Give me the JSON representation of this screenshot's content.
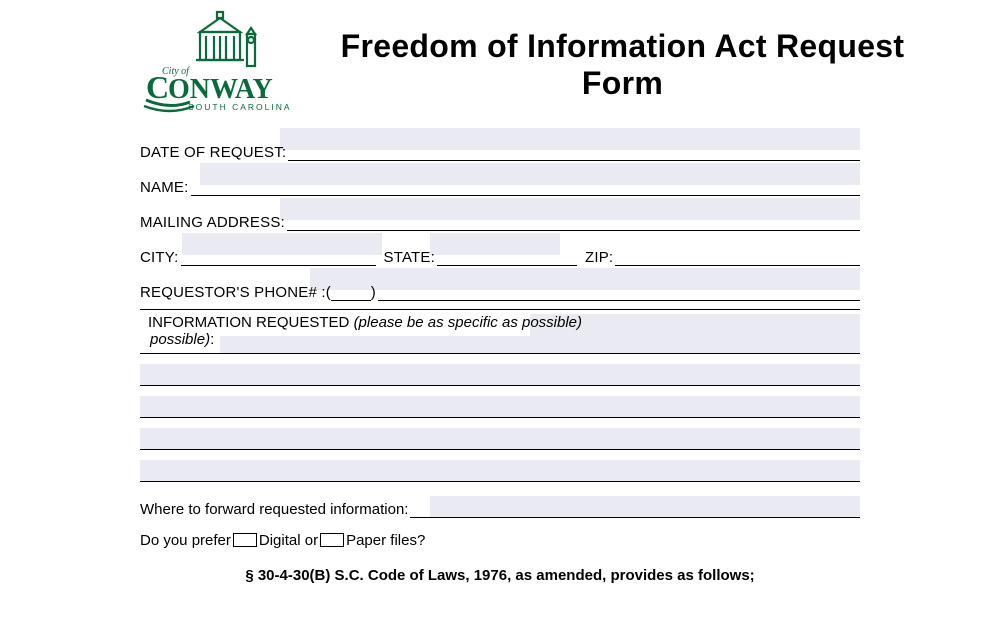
{
  "logo": {
    "line1": "City of",
    "line2": "ONWAY",
    "line3": "SOUTH CAROLINA"
  },
  "title": "Freedom of Information Act Request Form",
  "fields": {
    "date_label": "DATE OF REQUEST:",
    "name_label": "NAME:",
    "mailing_label": "MAILING ADDRESS:",
    "city_label": "CITY:",
    "state_label": "STATE:",
    "zip_label": "ZIP:",
    "phone_label": "REQUESTOR'S PHONE# :",
    "phone_paren_open": "(",
    "phone_paren_close": ")",
    "info_label": "INFORMATION REQUESTED ",
    "info_hint": "(please be as specific as possible)",
    "info_colon": ":",
    "forward_label": "Where to forward requested information: ",
    "prefer_prefix": "Do you prefer ",
    "prefer_digital": "Digital or ",
    "prefer_paper": "Paper files?"
  },
  "legal": "§ 30-4-30(B) S.C. Code of Laws, 1976, as amended, provides as follows;",
  "colors": {
    "green": "#0a6b3a",
    "fieldbg": "#eaeaf3"
  }
}
